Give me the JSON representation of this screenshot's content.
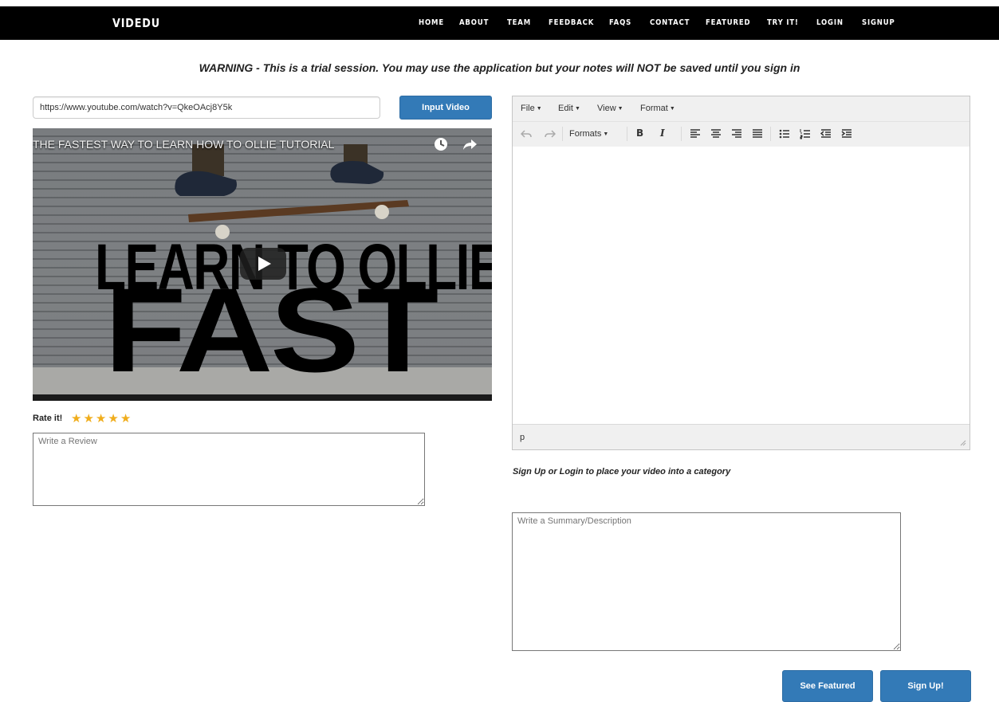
{
  "navbar": {
    "brand": "VIDEDU",
    "links": [
      "HOME",
      "ABOUT",
      "TEAM",
      "FEEDBACK",
      "FAQS",
      "CONTACT",
      "FEATURED",
      "TRY IT!",
      "LOGIN",
      "SIGNUP"
    ]
  },
  "warning": "WARNING - This is a trial session. You may use the application but your notes will NOT be saved until you sign in",
  "url_input": {
    "value": "https://www.youtube.com/watch?v=QkeOAcj8Y5k"
  },
  "input_video_label": "Input Video",
  "video": {
    "title": "THE FASTEST WAY TO LEARN HOW TO OLLIE TUTORIAL",
    "thumbnail_line1": "LEARN TO OLLIE",
    "thumbnail_line2": "FAST",
    "icons": [
      "clock-icon",
      "share-icon",
      "play-icon"
    ]
  },
  "rating": {
    "label": "Rate it!",
    "stars": [
      "★",
      "★",
      "★",
      "★",
      "★"
    ],
    "max": 5,
    "star_color": "#f0ad1c"
  },
  "review": {
    "placeholder": "Write a Review"
  },
  "editor": {
    "menu": [
      "File",
      "Edit",
      "View",
      "Format"
    ],
    "formats_label": "Formats",
    "bold": "B",
    "italic": "I",
    "status_path": "p"
  },
  "category_note": "Sign Up or Login to place your video into a category",
  "summary": {
    "placeholder": "Write a Summary/Description"
  },
  "buttons": {
    "see_featured": "See Featured",
    "sign_up": "Sign Up!"
  },
  "colors": {
    "primary": "#337ab7",
    "navbar": "#000000"
  }
}
